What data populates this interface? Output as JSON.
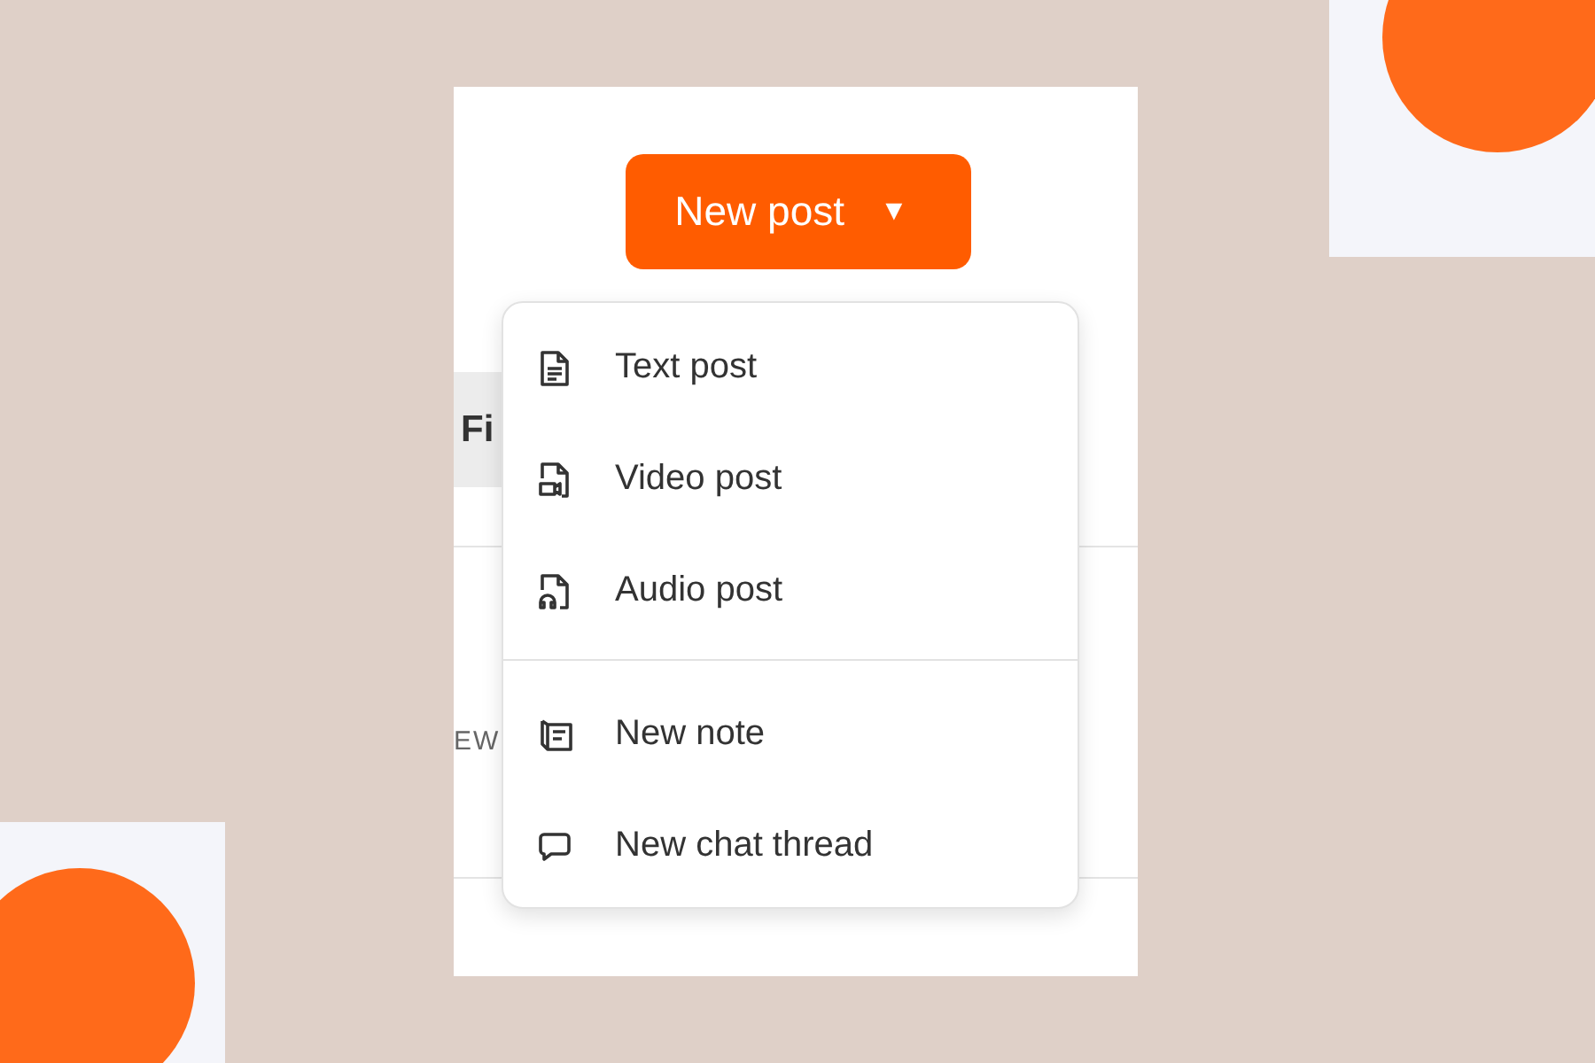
{
  "new_post_button": {
    "label": "New post",
    "caret": "▼"
  },
  "background_fragments": {
    "tab": "Fi",
    "label": "EW"
  },
  "menu": {
    "groups": [
      {
        "items": [
          {
            "kind": "text",
            "label": "Text post"
          },
          {
            "kind": "video",
            "label": "Video post"
          },
          {
            "kind": "audio",
            "label": "Audio post"
          }
        ]
      },
      {
        "items": [
          {
            "kind": "note",
            "label": "New note"
          },
          {
            "kind": "chat",
            "label": "New chat thread"
          }
        ]
      }
    ]
  }
}
